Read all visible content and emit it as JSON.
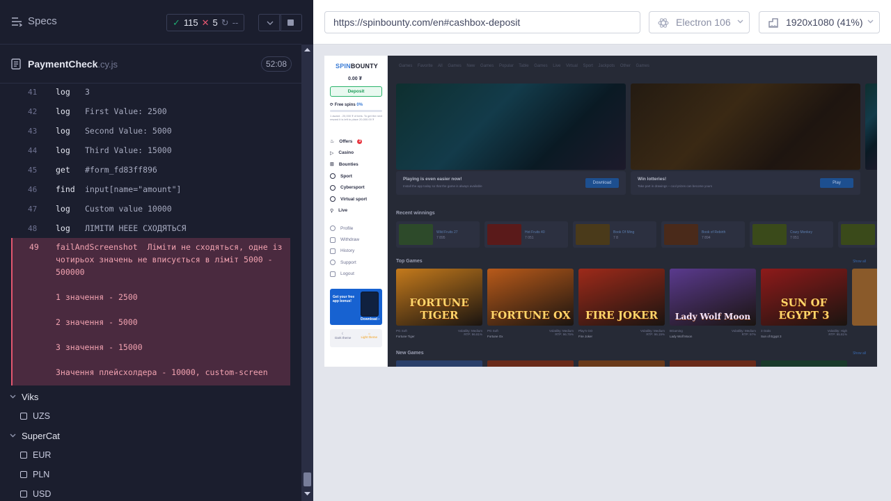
{
  "reporter": {
    "specs_label": "Specs",
    "passed": "115",
    "failed": "5",
    "pending": "--",
    "spec_file": {
      "name": "PaymentCheck",
      "ext": ".cy.js",
      "duration": "52:08"
    },
    "commands": [
      {
        "num": "41",
        "name": "log",
        "message": "3"
      },
      {
        "num": "42",
        "name": "log",
        "message": "First Value: 2500"
      },
      {
        "num": "43",
        "name": "log",
        "message": "Second Value: 5000"
      },
      {
        "num": "44",
        "name": "log",
        "message": "Third Value: 15000"
      },
      {
        "num": "45",
        "name": "get",
        "message": "#form_fd83ff896"
      },
      {
        "num": "46",
        "name": "find",
        "message": "input[name=\"amount\"]"
      },
      {
        "num": "47",
        "name": "log",
        "message": "Custom value 10000"
      },
      {
        "num": "48",
        "name": "log",
        "message": "ЛІМІТИ НЕЕЕ СХОДЯТЬСЯ"
      }
    ],
    "error": {
      "num": "49",
      "name": "failAndScreenshot",
      "line1": "Ліміти не сходяться, одне із чотирьох значень не вписується в ліміт 5000 - 500000",
      "line2": "1 значення - 2500",
      "line3": "2 значення - 5000",
      "line4": "3 значення - 15000",
      "line5": "Значення плейсхолдера - 10000, custom-screen"
    },
    "tree": {
      "suite1": "Viks",
      "suite1_tests": [
        "UZS"
      ],
      "suite2": "SuperCat",
      "suite2_tests": [
        "EUR",
        "PLN",
        "USD"
      ]
    }
  },
  "preview": {
    "url": "https://spinbounty.com/en#cashbox-deposit",
    "browser": "Electron 106",
    "viewport": "1920x1080  (41%)"
  },
  "app": {
    "logo_spin": "SPIN",
    "logo_bounty": "BOUNTY",
    "balance": "0.00 ₮",
    "deposit": "Deposit",
    "free_spins": "Free spins",
    "free_spins_pct": "0%",
    "free_spins_desc": "1 award - 20,000 ₮ of bets. To get the next reward it is left to place 20,000.00 ₮",
    "menu": [
      "Offers",
      "Casino",
      "Bounties",
      "Sport",
      "Cybersport",
      "Virtual sport",
      "Live"
    ],
    "offers_badge": "3",
    "menu2": [
      "Profile",
      "Withdraw",
      "History",
      "Support",
      "Logout"
    ],
    "promo_title": "Get your free app bonus!",
    "promo_btn": "Download",
    "theme_dark": "Dark theme",
    "theme_light": "Light theme",
    "nav": "Games Favorite All Games New Games Popular Table Games Live Virtual Sport Jackpots Other Games",
    "banner1_title": "Playing is even easier now!",
    "banner1_sub": "Install the app today so that the game is always available",
    "banner1_btn": "Download",
    "banner2_title": "Win lotteries!",
    "banner2_sub": "Take part in drawings – cool prizes can become yours",
    "banner2_btn": "Play",
    "recent_winnings": "Recent winnings",
    "wins": [
      {
        "game": "Wild Fruits 27",
        "amount": "7 895"
      },
      {
        "game": "Hot Fruits 40",
        "amount": "7 051"
      },
      {
        "game": "Book Of Ming",
        "amount": "7 8"
      },
      {
        "game": "Book of Rebirth",
        "amount": "7 894"
      },
      {
        "game": "Crazy Monkey",
        "amount": "7 051"
      }
    ],
    "top_games": "Top Games",
    "show_all": "Show all",
    "games": [
      {
        "title": "Fortune Tiger",
        "label": "FORTUNE TIGER",
        "provider": "PG Soft",
        "volatility": "Volatility: Medium",
        "rtp": "RTP: 96.81%",
        "bg": "#c47a1c"
      },
      {
        "title": "Fortune Ox",
        "label": "FORTUNE OX",
        "provider": "PG Soft",
        "volatility": "Volatility: Medium",
        "rtp": "RTP: 96.75%",
        "bg": "#b85a1a"
      },
      {
        "title": "Fire Joker",
        "label": "FIRE JOKER",
        "provider": "Play'n GO",
        "volatility": "Volatility: Medium",
        "rtp": "RTP: 96.15%",
        "bg": "#9e2a1a"
      },
      {
        "title": "Lady Wolf Moon",
        "label": "Lady Wolf Moon",
        "provider": "BGaming",
        "volatility": "Volatility: Medium",
        "rtp": "RTP: 97%",
        "bg": "#5a3a8e"
      },
      {
        "title": "Sun of Egypt 3",
        "label": "SUN OF EGYPT 3",
        "provider": "3 Oaks",
        "volatility": "Volatility: High",
        "rtp": "RTP: 95.81%",
        "bg": "#8e1a1a"
      }
    ],
    "new_games": "New Games"
  }
}
